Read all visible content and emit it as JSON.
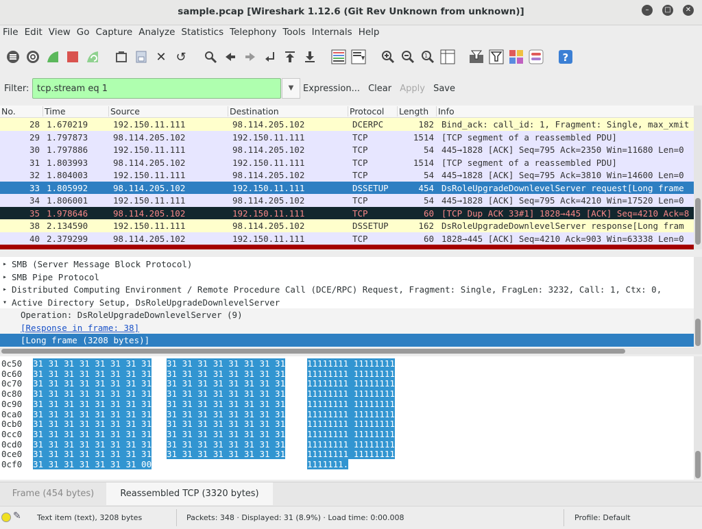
{
  "window": {
    "title": "sample.pcap  [Wireshark 1.12.6  (Git Rev Unknown from unknown)]"
  },
  "menu": [
    "File",
    "Edit",
    "View",
    "Go",
    "Capture",
    "Analyze",
    "Statistics",
    "Telephony",
    "Tools",
    "Internals",
    "Help"
  ],
  "toolbar": {
    "icons": [
      "interfaces-icon",
      "options-icon",
      "start-capture-icon",
      "stop-capture-icon",
      "restart-capture-icon",
      "open-file-icon",
      "save-file-icon",
      "close-file-icon",
      "reload-icon",
      "find-packet-icon",
      "go-back-icon",
      "go-forward-icon",
      "go-to-packet-icon",
      "go-first-icon",
      "go-last-icon",
      "colorize-icon",
      "autoscroll-icon",
      "zoom-in-icon",
      "zoom-out-icon",
      "normal-size-icon",
      "resize-columns-icon",
      "capture-filters-icon",
      "display-filters-icon",
      "coloring-rules-icon",
      "preferences-icon",
      "help-icon"
    ]
  },
  "filter": {
    "label": "Filter:",
    "value": "tcp.stream eq 1",
    "expression": "Expression...",
    "clear": "Clear",
    "apply": "Apply",
    "save": "Save"
  },
  "columns": [
    "No.",
    "Time",
    "Source",
    "Destination",
    "Protocol",
    "Length",
    "Info"
  ],
  "packets": [
    {
      "no": "28",
      "time": "1.670219",
      "src": "192.150.11.111",
      "dst": "98.114.205.102",
      "proto": "DCERPC",
      "len": "182",
      "info": "Bind_ack: call_id: 1, Fragment: Single, max_xmit",
      "bg": "#ffffcc",
      "fg": "#333333"
    },
    {
      "no": "29",
      "time": "1.797873",
      "src": "98.114.205.102",
      "dst": "192.150.11.111",
      "proto": "TCP",
      "len": "1514",
      "info": "[TCP segment of a reassembled PDU]",
      "bg": "#e7e6ff",
      "fg": "#333333"
    },
    {
      "no": "30",
      "time": "1.797886",
      "src": "192.150.11.111",
      "dst": "98.114.205.102",
      "proto": "TCP",
      "len": "54",
      "info": "445→1828 [ACK] Seq=795 Ack=2350 Win=11680 Len=0",
      "bg": "#e7e6ff",
      "fg": "#333333"
    },
    {
      "no": "31",
      "time": "1.803993",
      "src": "98.114.205.102",
      "dst": "192.150.11.111",
      "proto": "TCP",
      "len": "1514",
      "info": "[TCP segment of a reassembled PDU]",
      "bg": "#e7e6ff",
      "fg": "#333333"
    },
    {
      "no": "32",
      "time": "1.804003",
      "src": "192.150.11.111",
      "dst": "98.114.205.102",
      "proto": "TCP",
      "len": "54",
      "info": "445→1828 [ACK] Seq=795 Ack=3810 Win=14600 Len=0",
      "bg": "#e7e6ff",
      "fg": "#333333"
    },
    {
      "no": "33",
      "time": "1.805992",
      "src": "98.114.205.102",
      "dst": "192.150.11.111",
      "proto": "DSSETUP",
      "len": "454",
      "info": "DsRoleUpgradeDownlevelServer request[Long frame",
      "bg": "#2e7fc2",
      "fg": "#ffffff"
    },
    {
      "no": "34",
      "time": "1.806001",
      "src": "192.150.11.111",
      "dst": "98.114.205.102",
      "proto": "TCP",
      "len": "54",
      "info": "445→1828 [ACK] Seq=795 Ack=4210 Win=17520 Len=0",
      "bg": "#e7e6ff",
      "fg": "#333333"
    },
    {
      "no": "35",
      "time": "1.978646",
      "src": "98.114.205.102",
      "dst": "192.150.11.111",
      "proto": "TCP",
      "len": "60",
      "info": "[TCP Dup ACK 33#1] 1828→445 [ACK] Seq=4210 Ack=8",
      "bg": "#12272e",
      "fg": "#f78787"
    },
    {
      "no": "38",
      "time": "2.134590",
      "src": "192.150.11.111",
      "dst": "98.114.205.102",
      "proto": "DSSETUP",
      "len": "162",
      "info": "DsRoleUpgradeDownlevelServer response[Long fram",
      "bg": "#ffffcc",
      "fg": "#333333"
    },
    {
      "no": "40",
      "time": "2.379299",
      "src": "98.114.205.102",
      "dst": "192.150.11.111",
      "proto": "TCP",
      "len": "60",
      "info": "1828→445 [ACK] Seq=4210 Ack=903 Win=63338 Len=0",
      "bg": "#e7e6ff",
      "fg": "#333333"
    }
  ],
  "details": [
    {
      "text": "SMB (Server Message Block Protocol)",
      "arrow": "▸",
      "indent": 0,
      "link": false,
      "selected": false
    },
    {
      "text": "SMB Pipe Protocol",
      "arrow": "▸",
      "indent": 0,
      "link": false,
      "selected": false
    },
    {
      "text": "Distributed Computing Environment / Remote Procedure Call (DCE/RPC) Request, Fragment: Single, FragLen: 3232, Call: 1, Ctx: 0,",
      "arrow": "▸",
      "indent": 0,
      "link": false,
      "selected": false
    },
    {
      "text": "Active Directory Setup, DsRoleUpgradeDownlevelServer",
      "arrow": "▾",
      "indent": 0,
      "link": false,
      "selected": false
    },
    {
      "text": "Operation: DsRoleUpgradeDownlevelServer (9)",
      "arrow": "",
      "indent": 1,
      "link": false,
      "selected": false
    },
    {
      "text": "[Response in frame: 38]",
      "arrow": "",
      "indent": 1,
      "link": true,
      "selected": false
    },
    {
      "text": "[Long frame (3208 bytes)]",
      "arrow": "",
      "indent": 1,
      "link": false,
      "selected": true
    }
  ],
  "hex": [
    {
      "offset": "0c50",
      "hex1": "31 31 31 31 31 31 31 31",
      "hex2": "31 31 31 31 31 31 31 31",
      "ascii": "11111111 11111111"
    },
    {
      "offset": "0c60",
      "hex1": "31 31 31 31 31 31 31 31",
      "hex2": "31 31 31 31 31 31 31 31",
      "ascii": "11111111 11111111"
    },
    {
      "offset": "0c70",
      "hex1": "31 31 31 31 31 31 31 31",
      "hex2": "31 31 31 31 31 31 31 31",
      "ascii": "11111111 11111111"
    },
    {
      "offset": "0c80",
      "hex1": "31 31 31 31 31 31 31 31",
      "hex2": "31 31 31 31 31 31 31 31",
      "ascii": "11111111 11111111"
    },
    {
      "offset": "0c90",
      "hex1": "31 31 31 31 31 31 31 31",
      "hex2": "31 31 31 31 31 31 31 31",
      "ascii": "11111111 11111111"
    },
    {
      "offset": "0ca0",
      "hex1": "31 31 31 31 31 31 31 31",
      "hex2": "31 31 31 31 31 31 31 31",
      "ascii": "11111111 11111111"
    },
    {
      "offset": "0cb0",
      "hex1": "31 31 31 31 31 31 31 31",
      "hex2": "31 31 31 31 31 31 31 31",
      "ascii": "11111111 11111111"
    },
    {
      "offset": "0cc0",
      "hex1": "31 31 31 31 31 31 31 31",
      "hex2": "31 31 31 31 31 31 31 31",
      "ascii": "11111111 11111111"
    },
    {
      "offset": "0cd0",
      "hex1": "31 31 31 31 31 31 31 31",
      "hex2": "31 31 31 31 31 31 31 31",
      "ascii": "11111111 11111111"
    },
    {
      "offset": "0ce0",
      "hex1": "31 31 31 31 31 31 31 31",
      "hex2": "31 31 31 31 31 31 31 31",
      "ascii": "11111111 11111111"
    },
    {
      "offset": "0cf0",
      "hex1": "31 31 31 31 31 31 31 00",
      "hex2": "",
      "ascii": "1111111."
    }
  ],
  "bytetabs": [
    {
      "label": "Frame (454 bytes)",
      "active": false
    },
    {
      "label": "Reassembled TCP (3320 bytes)",
      "active": true
    }
  ],
  "status": {
    "item": "Text item (text), 3208 bytes",
    "stats": "Packets: 348 · Displayed: 31 (8.9%) · Load time: 0:00.008",
    "profile": "Profile: Default"
  }
}
